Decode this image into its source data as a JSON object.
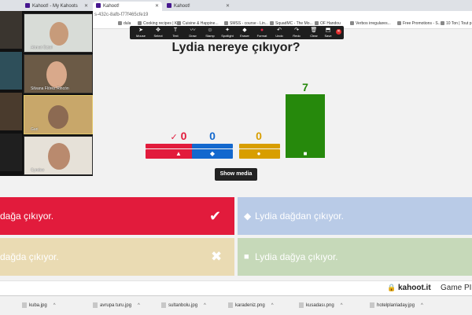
{
  "browser": {
    "tabs": [
      {
        "label": "Kahoot! - My Kahoots"
      },
      {
        "label": "Kahoot!"
      },
      {
        "label": "Kahoot!"
      }
    ],
    "url": "s-432c-8afb-f77f465cfe19",
    "bookmarks": [
      "dula",
      "Cooking recipes | K...",
      "Cuisine & Happine...",
      "SMSS - course - Lin...",
      "SquadMC - The Mo...",
      "OF Handou",
      "Verbos irregulares...",
      "Free Promotions - S...",
      "10 Ton | Tout p"
    ]
  },
  "zoom": {
    "tools": [
      {
        "label": "Mouse",
        "icon": "arrow-icon",
        "glyph": "➤"
      },
      {
        "label": "Select",
        "icon": "move-icon",
        "glyph": "✥"
      },
      {
        "label": "Text",
        "icon": "text-icon",
        "glyph": "T"
      },
      {
        "label": "Draw",
        "icon": "draw-icon",
        "glyph": "〰"
      },
      {
        "label": "Stamp",
        "icon": "stamp-icon",
        "glyph": "☺"
      },
      {
        "label": "Spotlight",
        "icon": "spotlight-icon",
        "glyph": "✦"
      },
      {
        "label": "Eraser",
        "icon": "eraser-icon",
        "glyph": "◆"
      },
      {
        "label": "Format",
        "icon": "format-icon",
        "glyph": "●"
      },
      {
        "label": "Undo",
        "icon": "undo-icon",
        "glyph": "↶"
      },
      {
        "label": "Redo",
        "icon": "redo-icon",
        "glyph": "↷"
      },
      {
        "label": "Clear",
        "icon": "clear-icon",
        "glyph": "🗑"
      },
      {
        "label": "Save",
        "icon": "save-icon",
        "glyph": "⬒"
      }
    ],
    "participants": [
      {
        "name": "Ahmet Öztel"
      },
      {
        "name": "Silvana Flórez Rincón"
      },
      {
        "name": "Gari"
      },
      {
        "name": "Cyndee"
      }
    ]
  },
  "question": "Lydia nereye çıkıyor?",
  "results": [
    {
      "count": "0",
      "color": "#e21b3c",
      "shape": "triangle-icon",
      "glyph": "▲",
      "correct": true
    },
    {
      "count": "0",
      "color": "#1368ce",
      "shape": "diamond-icon",
      "glyph": "◆",
      "correct": false
    },
    {
      "count": "0",
      "color": "#d89e00",
      "shape": "circle-icon",
      "glyph": "●",
      "correct": false
    },
    {
      "count": "7",
      "color": "#26890c",
      "shape": "square-icon",
      "glyph": "■",
      "correct": false
    }
  ],
  "show_media_label": "Show media",
  "answers": [
    {
      "text": "dağa çıkıyor.",
      "color": "#e21b3c",
      "status_icon": "check-icon"
    },
    {
      "text": "Lydia dağdan çıkıyor.",
      "color": "#b9cbe7",
      "shape": "diamond-icon"
    },
    {
      "text": "dağda çıkıyor.",
      "color": "#eadbb3",
      "status_icon": "close-icon"
    },
    {
      "text": "Lydia dağya çıkıyor.",
      "color": "#c6d9b9",
      "shape": "square-icon"
    }
  ],
  "footer": {
    "brand": "kahoot.it",
    "sub": "Game PI"
  },
  "downloads": [
    "kuba.jpg",
    "avrupa turu.jpg",
    "sultanbolu.jpg",
    "karadeniz.png",
    "kusadası.png",
    "hotelplanladay.jpg"
  ]
}
